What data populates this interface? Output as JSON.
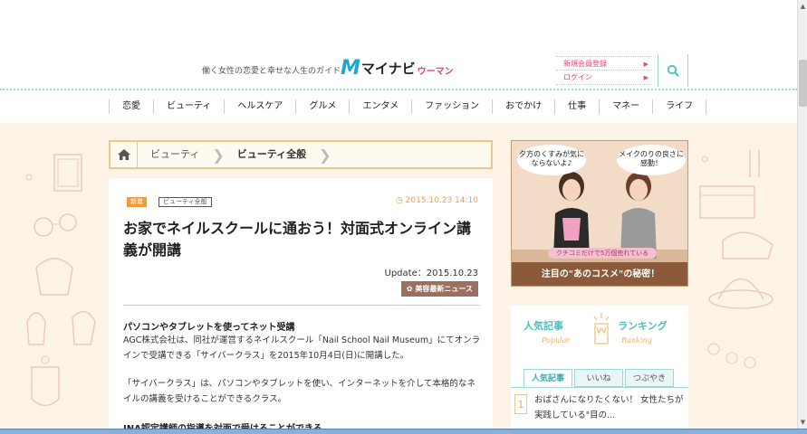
{
  "header": {
    "tagline": "働く女性の恋愛と幸せな人生のガイド",
    "logo_mark": "M",
    "logo_main": "マイナビ",
    "logo_sub": "ウーマン",
    "links": [
      {
        "label": "新規会員登録"
      },
      {
        "label": "ログイン"
      }
    ]
  },
  "nav": {
    "items": [
      "恋愛",
      "ビューティ",
      "ヘルスケア",
      "グルメ",
      "エンタメ",
      "ファッション",
      "おでかけ",
      "仕事",
      "マネー",
      "ライフ"
    ]
  },
  "breadcrumb": {
    "items": [
      "ビューティ",
      "ビューティ全般"
    ]
  },
  "article": {
    "tag_new": "新着",
    "tag_category": "ビューティ全般",
    "date": "2015.10.23 14:10",
    "title": "お家でネイルスクールに通おう！対面式オンライン講義が開講",
    "update": "Update：2015.10.23",
    "badge": "美容最新ニュース",
    "section_heading": "パソコンやタブレットを使ってネット受講",
    "paragraph1": "AGC株式会社は、同社が運営するネイルスクール「Nail School Nail Museum」にてオンラインで受講できる「サイバークラス」を2015年10月4日(日)に開講した。",
    "paragraph2": "「サイバークラス」は、パソコンやタブレットを使い、インターネットを介して本格的なネイルの講義を受けることができるクラス。",
    "section_heading2": "JNA認定講師の指導を対面で受けることができる"
  },
  "ad": {
    "bubble_left": "夕方のくすみが気にならないよ♪",
    "bubble_right": "メイクのりの良さに感動！",
    "strip": "クチコミだけで5万個売れている",
    "bottom": "注目の\"あのコスメ\"の秘密！"
  },
  "ranking": {
    "title_left": "人気記事",
    "title_right": "ランキング",
    "sub_left": "Popular",
    "sub_right": "Ranking",
    "tabs": [
      "人気記事",
      "いいね",
      "つぶやき"
    ],
    "top_number": "1",
    "top_text": "おばさんになりたくない！ 女性たちが実践している\"目の..."
  },
  "colors": {
    "accent_teal": "#4abfc4",
    "accent_pink": "#e8427c",
    "bg_cream": "#fdf3e7",
    "border_gold": "#e9c98b"
  }
}
